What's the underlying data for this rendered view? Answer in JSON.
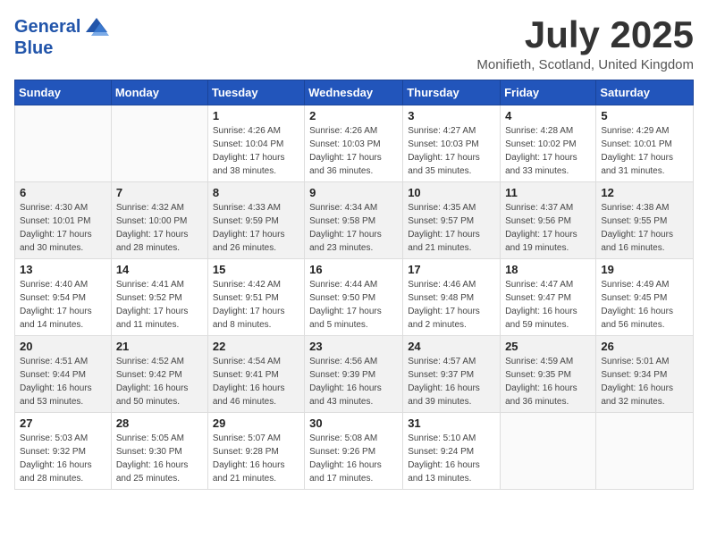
{
  "header": {
    "logo_line1": "General",
    "logo_line2": "Blue",
    "month_title": "July 2025",
    "location": "Monifieth, Scotland, United Kingdom"
  },
  "weekdays": [
    "Sunday",
    "Monday",
    "Tuesday",
    "Wednesday",
    "Thursday",
    "Friday",
    "Saturday"
  ],
  "weeks": [
    [
      {
        "day": "",
        "info": ""
      },
      {
        "day": "",
        "info": ""
      },
      {
        "day": "1",
        "info": "Sunrise: 4:26 AM\nSunset: 10:04 PM\nDaylight: 17 hours\nand 38 minutes."
      },
      {
        "day": "2",
        "info": "Sunrise: 4:26 AM\nSunset: 10:03 PM\nDaylight: 17 hours\nand 36 minutes."
      },
      {
        "day": "3",
        "info": "Sunrise: 4:27 AM\nSunset: 10:03 PM\nDaylight: 17 hours\nand 35 minutes."
      },
      {
        "day": "4",
        "info": "Sunrise: 4:28 AM\nSunset: 10:02 PM\nDaylight: 17 hours\nand 33 minutes."
      },
      {
        "day": "5",
        "info": "Sunrise: 4:29 AM\nSunset: 10:01 PM\nDaylight: 17 hours\nand 31 minutes."
      }
    ],
    [
      {
        "day": "6",
        "info": "Sunrise: 4:30 AM\nSunset: 10:01 PM\nDaylight: 17 hours\nand 30 minutes."
      },
      {
        "day": "7",
        "info": "Sunrise: 4:32 AM\nSunset: 10:00 PM\nDaylight: 17 hours\nand 28 minutes."
      },
      {
        "day": "8",
        "info": "Sunrise: 4:33 AM\nSunset: 9:59 PM\nDaylight: 17 hours\nand 26 minutes."
      },
      {
        "day": "9",
        "info": "Sunrise: 4:34 AM\nSunset: 9:58 PM\nDaylight: 17 hours\nand 23 minutes."
      },
      {
        "day": "10",
        "info": "Sunrise: 4:35 AM\nSunset: 9:57 PM\nDaylight: 17 hours\nand 21 minutes."
      },
      {
        "day": "11",
        "info": "Sunrise: 4:37 AM\nSunset: 9:56 PM\nDaylight: 17 hours\nand 19 minutes."
      },
      {
        "day": "12",
        "info": "Sunrise: 4:38 AM\nSunset: 9:55 PM\nDaylight: 17 hours\nand 16 minutes."
      }
    ],
    [
      {
        "day": "13",
        "info": "Sunrise: 4:40 AM\nSunset: 9:54 PM\nDaylight: 17 hours\nand 14 minutes."
      },
      {
        "day": "14",
        "info": "Sunrise: 4:41 AM\nSunset: 9:52 PM\nDaylight: 17 hours\nand 11 minutes."
      },
      {
        "day": "15",
        "info": "Sunrise: 4:42 AM\nSunset: 9:51 PM\nDaylight: 17 hours\nand 8 minutes."
      },
      {
        "day": "16",
        "info": "Sunrise: 4:44 AM\nSunset: 9:50 PM\nDaylight: 17 hours\nand 5 minutes."
      },
      {
        "day": "17",
        "info": "Sunrise: 4:46 AM\nSunset: 9:48 PM\nDaylight: 17 hours\nand 2 minutes."
      },
      {
        "day": "18",
        "info": "Sunrise: 4:47 AM\nSunset: 9:47 PM\nDaylight: 16 hours\nand 59 minutes."
      },
      {
        "day": "19",
        "info": "Sunrise: 4:49 AM\nSunset: 9:45 PM\nDaylight: 16 hours\nand 56 minutes."
      }
    ],
    [
      {
        "day": "20",
        "info": "Sunrise: 4:51 AM\nSunset: 9:44 PM\nDaylight: 16 hours\nand 53 minutes."
      },
      {
        "day": "21",
        "info": "Sunrise: 4:52 AM\nSunset: 9:42 PM\nDaylight: 16 hours\nand 50 minutes."
      },
      {
        "day": "22",
        "info": "Sunrise: 4:54 AM\nSunset: 9:41 PM\nDaylight: 16 hours\nand 46 minutes."
      },
      {
        "day": "23",
        "info": "Sunrise: 4:56 AM\nSunset: 9:39 PM\nDaylight: 16 hours\nand 43 minutes."
      },
      {
        "day": "24",
        "info": "Sunrise: 4:57 AM\nSunset: 9:37 PM\nDaylight: 16 hours\nand 39 minutes."
      },
      {
        "day": "25",
        "info": "Sunrise: 4:59 AM\nSunset: 9:35 PM\nDaylight: 16 hours\nand 36 minutes."
      },
      {
        "day": "26",
        "info": "Sunrise: 5:01 AM\nSunset: 9:34 PM\nDaylight: 16 hours\nand 32 minutes."
      }
    ],
    [
      {
        "day": "27",
        "info": "Sunrise: 5:03 AM\nSunset: 9:32 PM\nDaylight: 16 hours\nand 28 minutes."
      },
      {
        "day": "28",
        "info": "Sunrise: 5:05 AM\nSunset: 9:30 PM\nDaylight: 16 hours\nand 25 minutes."
      },
      {
        "day": "29",
        "info": "Sunrise: 5:07 AM\nSunset: 9:28 PM\nDaylight: 16 hours\nand 21 minutes."
      },
      {
        "day": "30",
        "info": "Sunrise: 5:08 AM\nSunset: 9:26 PM\nDaylight: 16 hours\nand 17 minutes."
      },
      {
        "day": "31",
        "info": "Sunrise: 5:10 AM\nSunset: 9:24 PM\nDaylight: 16 hours\nand 13 minutes."
      },
      {
        "day": "",
        "info": ""
      },
      {
        "day": "",
        "info": ""
      }
    ]
  ]
}
